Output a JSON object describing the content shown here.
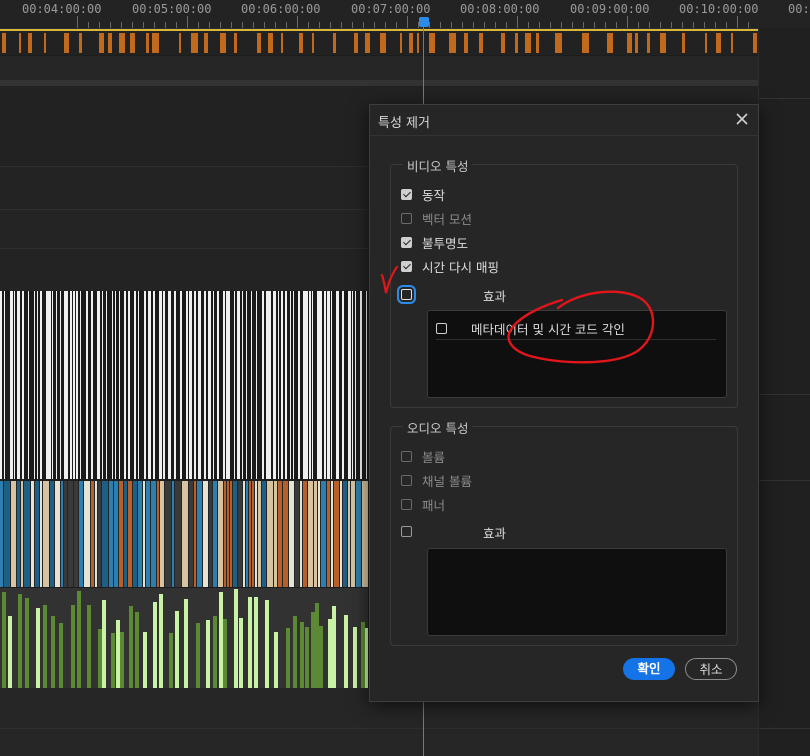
{
  "timeline": {
    "ruler_labels": [
      "00:04:00:00",
      "00:05:00:00",
      "00:06:00:00",
      "00:07:00:00",
      "00:08:00:00",
      "00:09:00:00",
      "00:10:00:00",
      "00:1"
    ]
  },
  "dialog": {
    "title": "특성 제거",
    "video": {
      "group_title": "비디오 특성",
      "options": [
        {
          "label": "동작",
          "checked": true,
          "enabled": true
        },
        {
          "label": "벡터 모션",
          "checked": false,
          "enabled": false
        },
        {
          "label": "불투명도",
          "checked": true,
          "enabled": true
        },
        {
          "label": "시간 다시 매핑",
          "checked": true,
          "enabled": true
        }
      ],
      "effects_label": "효과",
      "effects_checked": false,
      "effect_items": [
        {
          "label": "메타데이터 및 시간 코드 각인",
          "checked": false
        }
      ]
    },
    "audio": {
      "group_title": "오디오 특성",
      "options": [
        {
          "label": "볼륨",
          "checked": false,
          "enabled": false
        },
        {
          "label": "채널 볼륨",
          "checked": false,
          "enabled": false
        },
        {
          "label": "패너",
          "checked": false,
          "enabled": false
        }
      ],
      "effects_label": "효과",
      "effects_checked": false
    },
    "ok_label": "확인",
    "cancel_label": "취소"
  },
  "colors": {
    "accent": "#1473e6",
    "playhead": "#2d8ceb",
    "clip_orange": "#c16a1d",
    "annotation_red": "#e0161b"
  }
}
